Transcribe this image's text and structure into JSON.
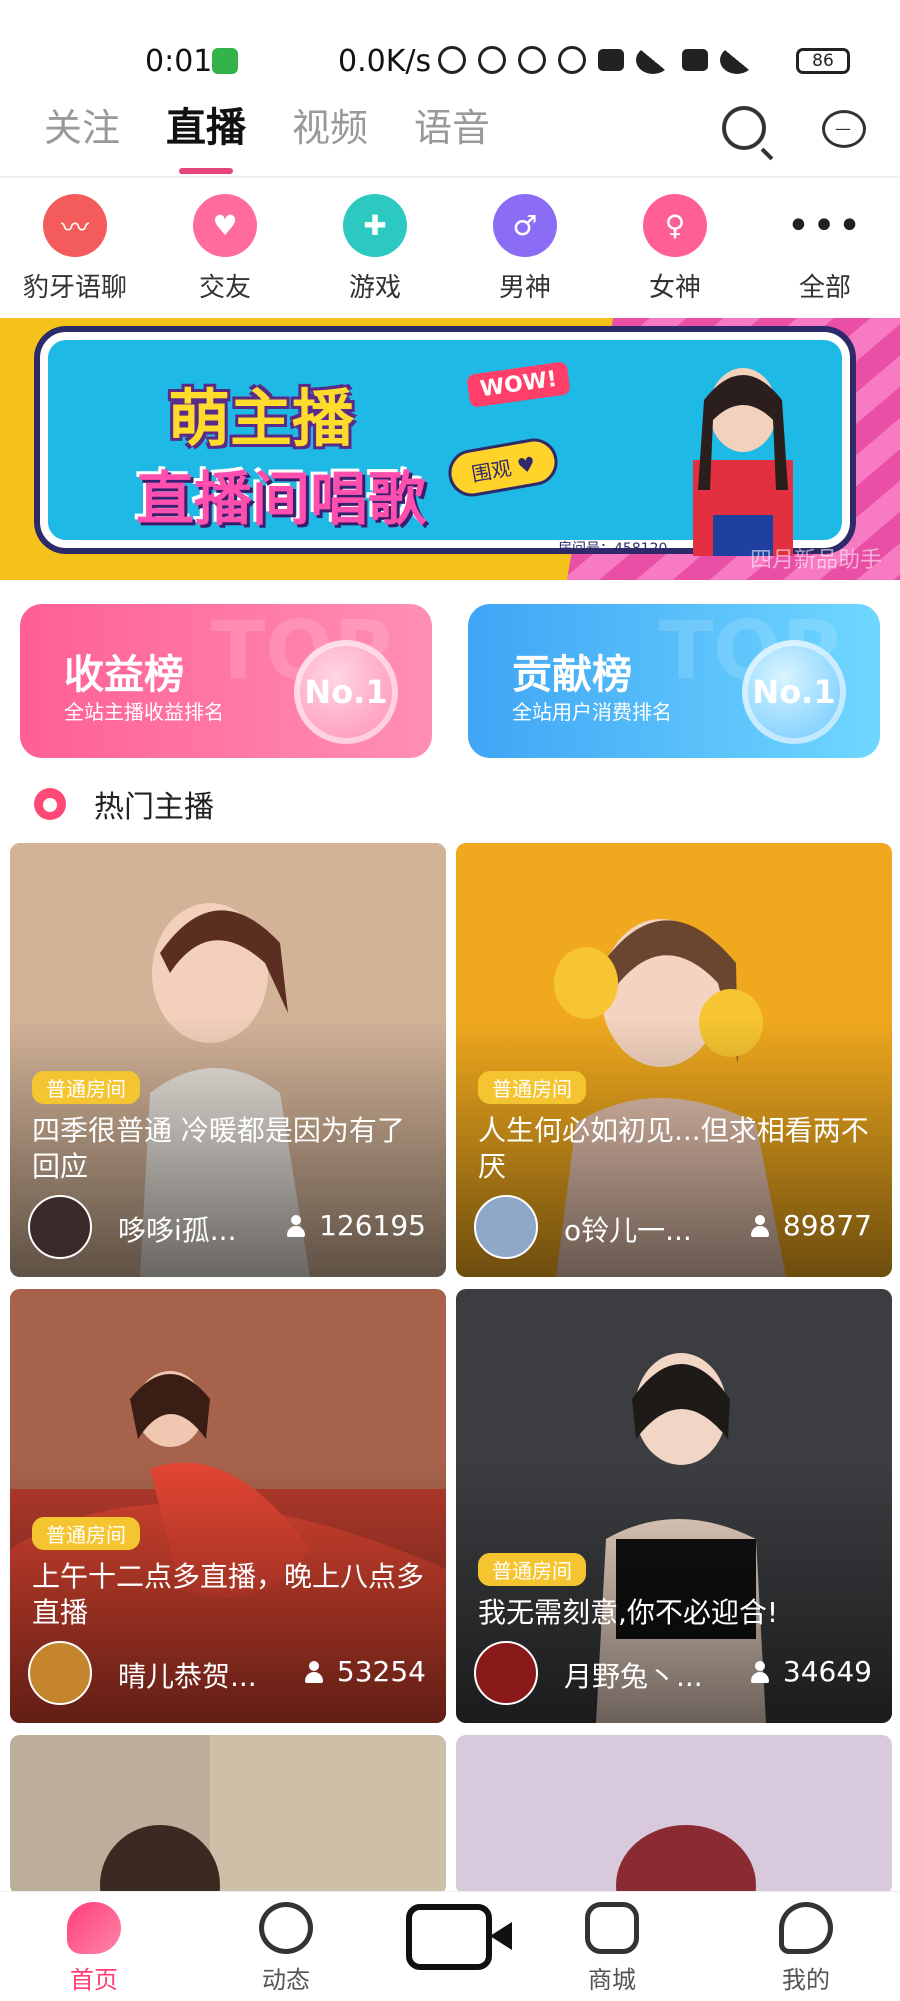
{
  "status_bar": {
    "time": "0:01",
    "speed": "0.0K/s",
    "battery": "86"
  },
  "top_tabs": [
    {
      "label": "关注",
      "active": false
    },
    {
      "label": "直播",
      "active": true
    },
    {
      "label": "视频",
      "active": false
    },
    {
      "label": "语音",
      "active": false
    }
  ],
  "categories": [
    {
      "label": "豹牙语聊",
      "icon": "voice-chat-icon",
      "color": "#f45b5b"
    },
    {
      "label": "交友",
      "icon": "heart-icon",
      "color": "#ff6b9a"
    },
    {
      "label": "游戏",
      "icon": "gamepad-icon",
      "color": "#2cc9c0"
    },
    {
      "label": "男神",
      "icon": "suit-icon",
      "color": "#8a6cf5"
    },
    {
      "label": "女神",
      "icon": "dress-icon",
      "color": "#ff5f95"
    },
    {
      "label": "全部",
      "icon": "more-dots-icon",
      "color": "#222222"
    }
  ],
  "banner": {
    "title": "萌主播",
    "subtitle": "直播间唱歌",
    "wow": "WOW!",
    "button": "围观 ♥",
    "room": "房间号：458120",
    "watermark": "四月新品助手"
  },
  "rankings": {
    "income": {
      "title": "收益榜",
      "subtitle": "全站主播收益排名",
      "badge": "No.1",
      "bg": "TOP"
    },
    "contribution": {
      "title": "贡献榜",
      "subtitle": "全站用户消费排名",
      "badge": "No.1",
      "bg": "TOP"
    }
  },
  "section": {
    "title": "热门主播"
  },
  "streams": [
    {
      "tag": "普通房间",
      "title": "四季很普通 冷暖都是因为有了回应",
      "name": "哆哆i孤...",
      "viewers": "126195"
    },
    {
      "tag": "普通房间",
      "title": "人生何必如初见...但求相看两不厌",
      "name": "o铃儿一...",
      "viewers": "89877"
    },
    {
      "tag": "普通房间",
      "title": "上午十二点多直播，晚上八点多直播",
      "name": "晴儿恭贺...",
      "viewers": "53254"
    },
    {
      "tag": "普通房间",
      "title": "我无需刻意,你不必迎合!",
      "name": "月野兔丶...",
      "viewers": "34649"
    }
  ],
  "bottom_nav": [
    {
      "label": "首页",
      "active": true
    },
    {
      "label": "动态",
      "active": false
    },
    {
      "label": "",
      "active": false
    },
    {
      "label": "商城",
      "active": false
    },
    {
      "label": "我的",
      "active": false
    }
  ]
}
